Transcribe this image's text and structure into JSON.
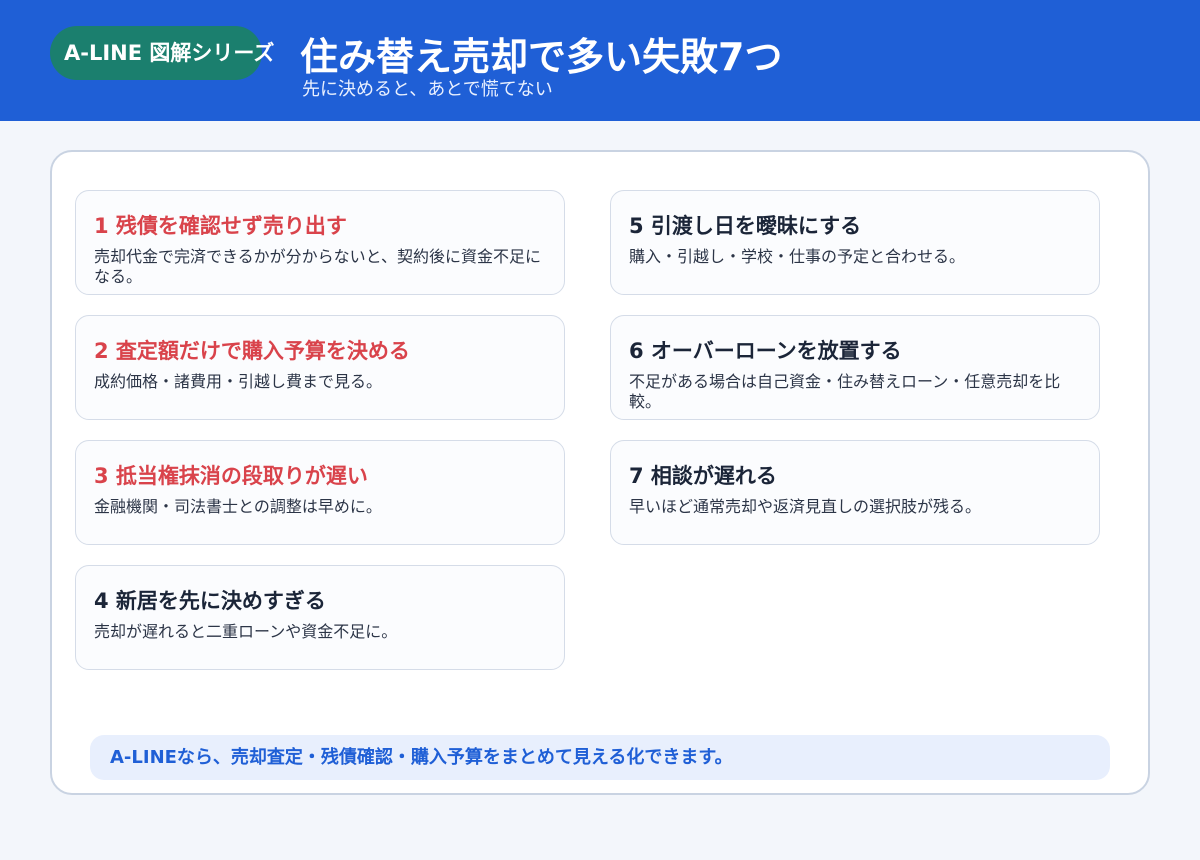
{
  "header": {
    "badge": "A-LINE 図解シリーズ",
    "title": "住み替え売却で多い失敗7つ",
    "subtitle": "先に決めると、あとで慌てない"
  },
  "items": [
    {
      "title": "1 残債を確認せず売り出す",
      "desc": "売却代金で完済できるかが分からないと、契約後に資金不足になる。",
      "accent": "#d9434b"
    },
    {
      "title": "2 査定額だけで購入予算を決める",
      "desc": "成約価格・諸費用・引越し費まで見る。",
      "accent": "#d9434b"
    },
    {
      "title": "3 抵当権抹消の段取りが遅い",
      "desc": "金融機関・司法書士との調整は早めに。",
      "accent": "#d9434b"
    },
    {
      "title": "4 新居を先に決めすぎる",
      "desc": "売却が遅れると二重ローンや資金不足に。",
      "accent": "#1b2538"
    },
    {
      "title": "5 引渡し日を曖昧にする",
      "desc": "購入・引越し・学校・仕事の予定と合わせる。",
      "accent": "#1b2538"
    },
    {
      "title": "6 オーバーローンを放置する",
      "desc": "不足がある場合は自己資金・住み替えローン・任意売却を比較。",
      "accent": "#1b2538"
    },
    {
      "title": "7 相談が遅れる",
      "desc": "早いほど通常売却や返済見直しの選択肢が残る。",
      "accent": "#1b2538"
    }
  ],
  "footer": "A-LINEなら、売却査定・残債確認・購入予算をまとめて見える化できます。",
  "colors": {
    "header_bg": "#1f5fd6",
    "badge_bg": "#1b7f6e",
    "warning_red": "#d9434b",
    "footer_text": "#1f5fd6"
  }
}
